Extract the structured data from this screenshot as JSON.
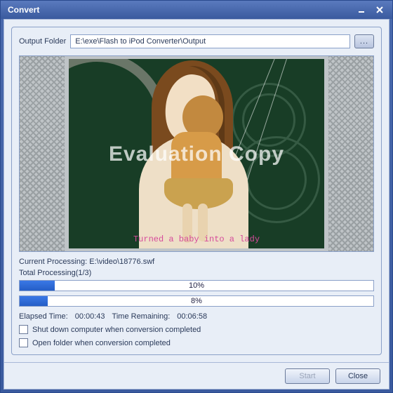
{
  "titlebar": {
    "title": "Convert"
  },
  "output": {
    "label": "Output Folder",
    "path": "E:\\exe\\Flash to iPod Converter\\Output",
    "browse": "..."
  },
  "preview": {
    "watermark": "Evaluation Copy",
    "caption": "Turned a baby into a lady"
  },
  "status": {
    "current_label": "Current Processing:",
    "current_file": "E:\\video\\18776.swf",
    "total_label": "Total Processing(1/3)",
    "current_pct": 10,
    "current_pct_text": "10%",
    "total_pct": 8,
    "total_pct_text": "8%",
    "elapsed_label": "Elapsed Time:",
    "elapsed": "00:00:43",
    "remaining_label": "Time Remaining:",
    "remaining": "00:06:58"
  },
  "options": {
    "shutdown": "Shut down computer when conversion completed",
    "openfolder": "Open folder  when conversion completed"
  },
  "footer": {
    "start": "Start",
    "close": "Close"
  }
}
